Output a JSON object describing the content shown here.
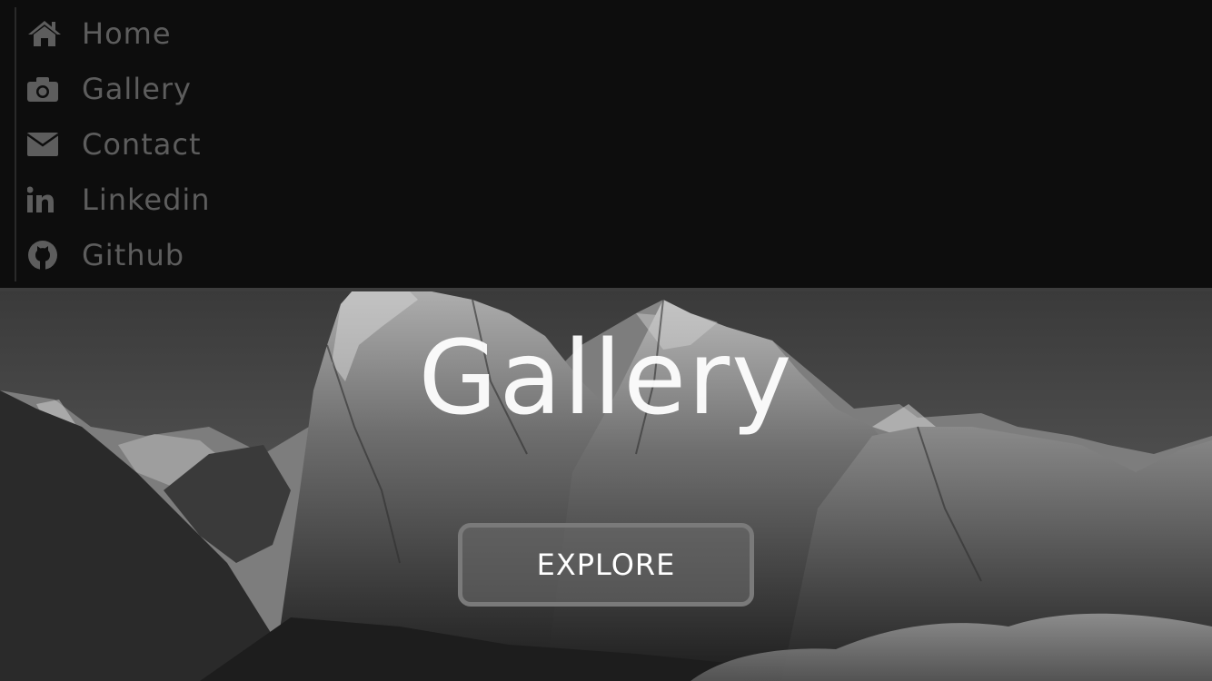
{
  "nav": {
    "items": [
      {
        "label": "Home",
        "icon": "home-icon"
      },
      {
        "label": "Gallery",
        "icon": "camera-icon"
      },
      {
        "label": "Contact",
        "icon": "envelope-icon"
      },
      {
        "label": "Linkedin",
        "icon": "linkedin-icon"
      },
      {
        "label": "Github",
        "icon": "github-icon"
      }
    ]
  },
  "hero": {
    "title": "Gallery",
    "button_label": "EXPLORE"
  },
  "colors": {
    "menu_background": "#0d0d0d",
    "menu_text": "#5d5d5d",
    "title_text": "#ffffff"
  }
}
